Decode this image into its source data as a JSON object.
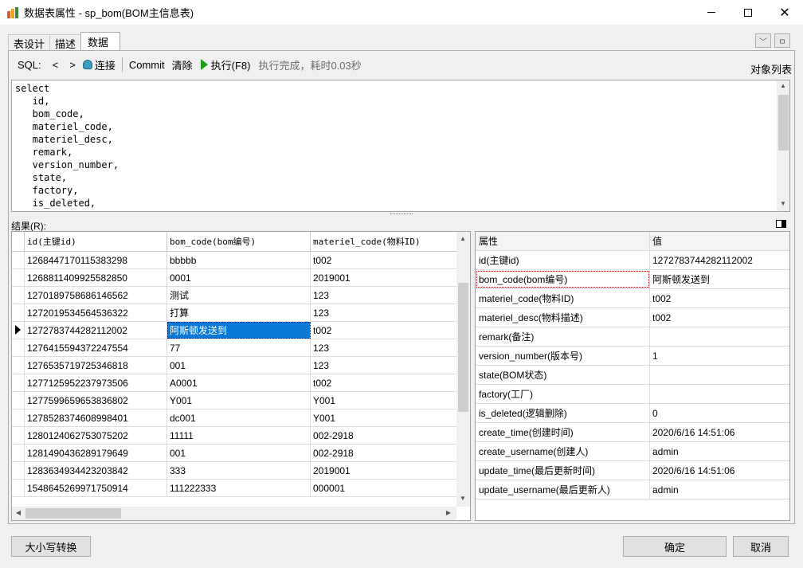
{
  "window": {
    "title": "数据表属性 - sp_bom(BOM主信息表)"
  },
  "tabs": [
    {
      "label": "表设计"
    },
    {
      "label": "描述"
    },
    {
      "label": "数据"
    }
  ],
  "tab_tools": {
    "dropdown": "﹀",
    "pin": "ㅁ"
  },
  "toolbar": {
    "sql_label": "SQL:",
    "prev": "<",
    "next": ">",
    "connect": "连接",
    "commit": "Commit",
    "clear": "清除",
    "execute": "执行(F8)",
    "status": "执行完成，耗时0.03秒",
    "object_list": "对象列表"
  },
  "sql": {
    "text": "select\n   id,\n   bom_code,\n   materiel_code,\n   materiel_desc,\n   remark,\n   version_number,\n   state,\n   factory,\n   is_deleted,"
  },
  "result": {
    "label": "结果(R):",
    "columns": [
      "id(主键id)",
      "bom_code(bom编号)",
      "materiel_code(物料ID)"
    ],
    "rows": [
      [
        "1268447170115383298",
        "bbbbb",
        "t002"
      ],
      [
        "1268811409925582850",
        "0001",
        "2019001"
      ],
      [
        "1270189758686146562",
        "测试",
        "123"
      ],
      [
        "1272019534564536322",
        "打算",
        "123"
      ],
      [
        "1272783744282112002",
        "阿斯顿发送到",
        "t002"
      ],
      [
        "1276415594372247554",
        "77",
        "123"
      ],
      [
        "1276535719725346818",
        "001",
        "123"
      ],
      [
        "1277125952237973506",
        "A0001",
        "t002"
      ],
      [
        "1277599659653836802",
        "Y001",
        "Y001"
      ],
      [
        "1278528374608998401",
        "dc001",
        "Y001"
      ],
      [
        "1280124062753075202",
        "11111",
        "002-2918"
      ],
      [
        "1281490436289179649",
        "001",
        "002-2918"
      ],
      [
        "1283634934423203842",
        "333",
        "2019001"
      ],
      [
        "1548645269971750914",
        "111222333",
        "000001"
      ]
    ]
  },
  "properties": {
    "header": {
      "name": "属性",
      "value": "值"
    },
    "rows": [
      {
        "name": "id(主键id)",
        "value": "1272783744282112002"
      },
      {
        "name": "bom_code(bom编号)",
        "value": "阿斯顿发送到"
      },
      {
        "name": "materiel_code(物料ID)",
        "value": "t002"
      },
      {
        "name": "materiel_desc(物料描述)",
        "value": "t002"
      },
      {
        "name": "remark(备注)",
        "value": ""
      },
      {
        "name": "version_number(版本号)",
        "value": "1"
      },
      {
        "name": "state(BOM状态)",
        "value": ""
      },
      {
        "name": "factory(工厂)",
        "value": ""
      },
      {
        "name": "is_deleted(逻辑删除)",
        "value": "0"
      },
      {
        "name": "create_time(创建时间)",
        "value": "2020/6/16 14:51:06"
      },
      {
        "name": "create_username(创建人)",
        "value": "admin"
      },
      {
        "name": "update_time(最后更新时间)",
        "value": "2020/6/16 14:51:06"
      },
      {
        "name": "update_username(最后更新人)",
        "value": "admin"
      }
    ]
  },
  "buttons": {
    "case_convert": "大小写转换",
    "ok": "确定",
    "cancel": "取消"
  }
}
